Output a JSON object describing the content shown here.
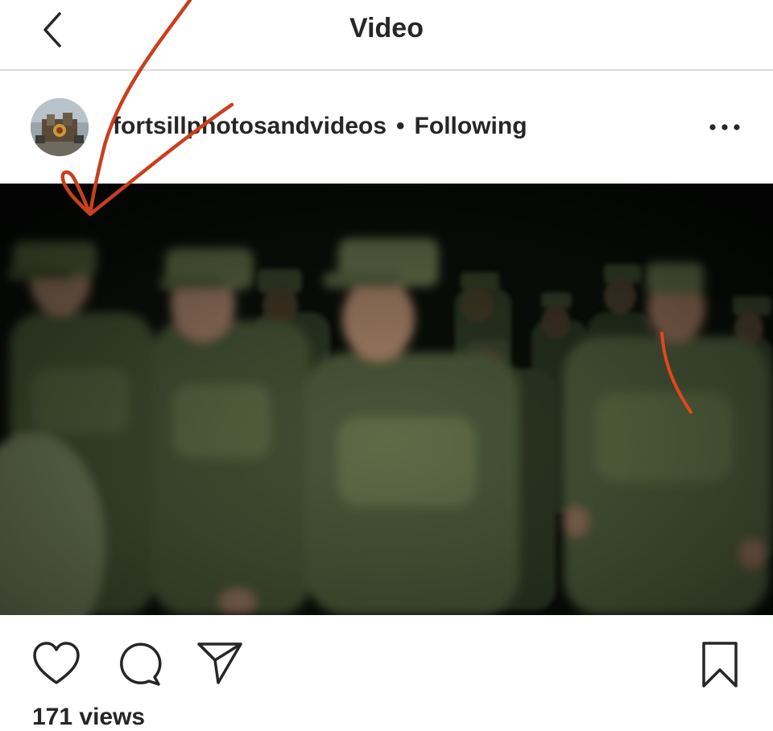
{
  "header": {
    "title": "Video",
    "back_icon": "chevron-left-icon"
  },
  "post": {
    "username": "fortsillphotosandvideos",
    "separator": "•",
    "follow_status": "Following",
    "more_icon": "more-horizontal-icon"
  },
  "actions": {
    "like_icon": "heart-icon",
    "comment_icon": "comment-icon",
    "share_icon": "send-icon",
    "save_icon": "bookmark-icon"
  },
  "footer": {
    "views_text": "171 views"
  },
  "colors": {
    "text": "#262626",
    "divider": "#dbdbdb",
    "annotation": "#c8401e"
  }
}
